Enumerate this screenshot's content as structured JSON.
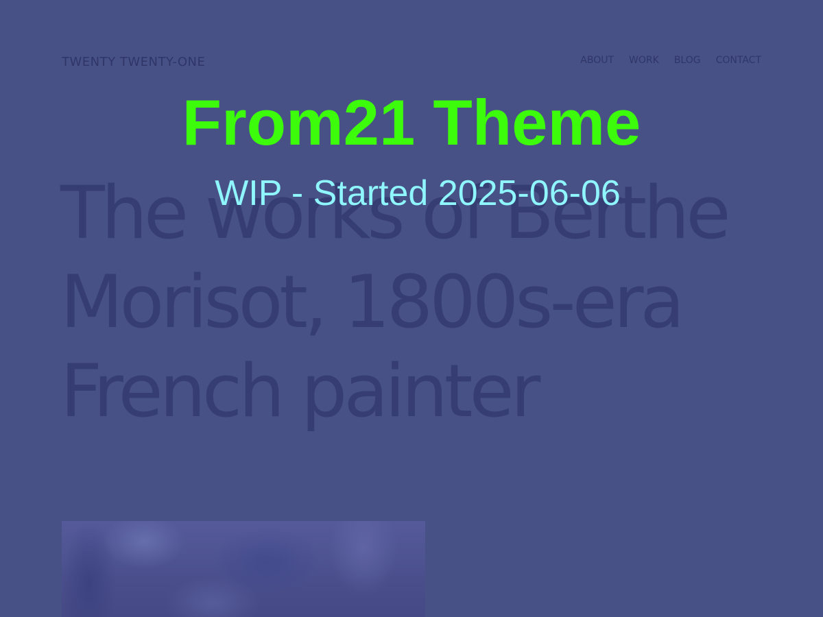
{
  "site": {
    "title": "TWENTY TWENTY-ONE"
  },
  "nav": {
    "items": [
      {
        "label": "ABOUT"
      },
      {
        "label": "WORK"
      },
      {
        "label": "BLOG"
      },
      {
        "label": "CONTACT"
      }
    ]
  },
  "main": {
    "headline": "The works of Berthe Morisot, 1800s-era French painter"
  },
  "overlay": {
    "title": "From21 Theme",
    "subtitle": "WIP - Started 2025-06-06"
  },
  "colors": {
    "background": "#485186",
    "overlay_title": "#3dfc0b",
    "overlay_subtitle": "#8ef6fc",
    "muted_text": "#2f3567"
  }
}
